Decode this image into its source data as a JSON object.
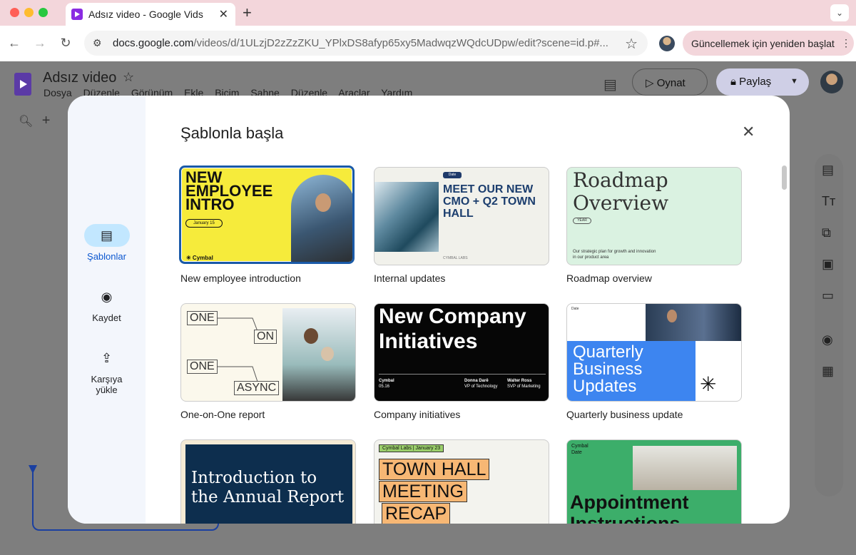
{
  "browser": {
    "tab_title": "Adsız video - Google Vids",
    "url_domain": "docs.google.com",
    "url_path": "/videos/d/1ULzjD2zZzZKU_YPlxDS8afyp65xy5MadwqzWQdcUDpw/edit?scene=id.p#...",
    "restart_label": "Güncellemek için yeniden başlat"
  },
  "app": {
    "title": "Adsız video",
    "menus": [
      "Dosya",
      "Düzenle",
      "Görünüm",
      "Ekle",
      "Biçim",
      "Sahne",
      "Düzenle",
      "Araçlar",
      "Yardım"
    ],
    "play_label": "Oynat",
    "share_label": "Paylaş"
  },
  "modal": {
    "title": "Şablonla başla",
    "side_items": [
      "Şablonlar",
      "Kaydet",
      "Karşıya yükle"
    ],
    "templates": [
      {
        "caption": "New employee introduction",
        "title": "NEW EMPLOYEE INTRO",
        "date": "January 15",
        "brand": "✳ Cymbal"
      },
      {
        "caption": "Internal updates",
        "title": "MEET OUR NEW CMO + Q2 TOWN HALL",
        "date": "Date",
        "footer": "CYMBAL LABS"
      },
      {
        "caption": "Roadmap overview",
        "title": "Roadmap Overview",
        "year": "YEAR",
        "sub": "Our strategic plan for growth and innovation in our product area"
      },
      {
        "caption": "One-on-One report",
        "boxes": [
          "ONE",
          "ON",
          "ONE",
          "ASYNC"
        ]
      },
      {
        "caption": "Company initiatives",
        "title": "New Company Initiatives",
        "brand": "Cymbal",
        "date": "05.16",
        "p1_name": "Donna Darë",
        "p1_role": "VP of Technology",
        "p2_name": "Walter Ross",
        "p2_role": "SVP of Marketing"
      },
      {
        "caption": "Quarterly business update",
        "title": "Quarterly Business Updates",
        "date": "Date"
      },
      {
        "caption": "",
        "title": "Introduction to the Annual Report"
      },
      {
        "caption": "",
        "tag": "Cymbal Labs | January 23",
        "lines": [
          "TOWN HALL",
          "MEETING",
          "RECAP"
        ]
      },
      {
        "caption": "",
        "brand": "Cymbal",
        "date": "Date",
        "title": "Appointment Instructions"
      }
    ]
  },
  "colors": {
    "accent": "#0b57d0",
    "selected_border": "#1a5aa8",
    "tab_bar": "#f3d6db"
  }
}
